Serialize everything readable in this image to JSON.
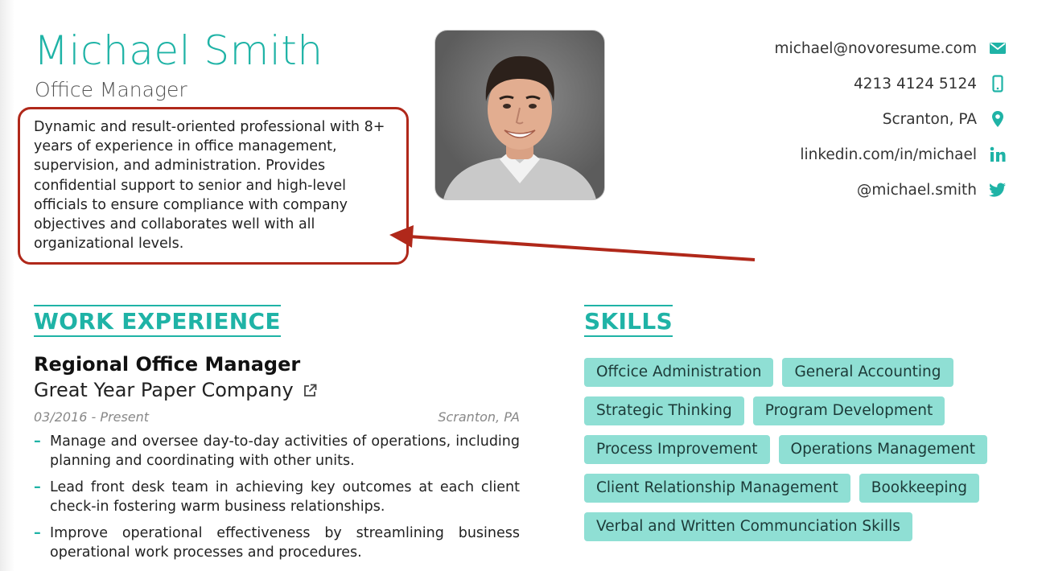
{
  "header": {
    "name": "Michael Smith",
    "role": "Office Manager",
    "summary": "Dynamic and result-oriented professional with 8+ years of experience in office management, supervision, and administration. Provides confidential support to senior and high-level officials to ensure compliance with company objectives and collaborates well with all organizational levels."
  },
  "contact": [
    {
      "text": "michael@novoresume.com",
      "icon": "envelope-icon"
    },
    {
      "text": "4213 4124 5124",
      "icon": "phone-icon"
    },
    {
      "text": "Scranton, PA",
      "icon": "location-pin-icon"
    },
    {
      "text": "linkedin.com/in/michael",
      "icon": "linkedin-icon"
    },
    {
      "text": "@michael.smith",
      "icon": "twitter-icon"
    }
  ],
  "work": {
    "section_title": "WORK EXPERIENCE",
    "job_title": "Regional Office Manager",
    "company": "Great Year Paper Company",
    "dates": "03/2016 - Present",
    "location": "Scranton, PA",
    "bullets": [
      "Manage and oversee day-to-day activities of operations, including planning and coordinating with other units.",
      "Lead front desk team in achieving key outcomes at each client check-in fostering warm business relationships.",
      "Improve operational effectiveness by streamlining business operational work processes and procedures."
    ]
  },
  "skills": {
    "section_title": "SKILLS",
    "items": [
      "Offcice Administration",
      "General Accounting",
      "Strategic Thinking",
      "Program Development",
      "Process Improvement",
      "Operations Management",
      "Client Relationship Management",
      "Bookkeeping",
      "Verbal and Written Communciation Skills"
    ]
  },
  "colors": {
    "accent": "#1fb3a6",
    "skill_tag": "#8fdfd4",
    "annotation": "#b0281a"
  }
}
